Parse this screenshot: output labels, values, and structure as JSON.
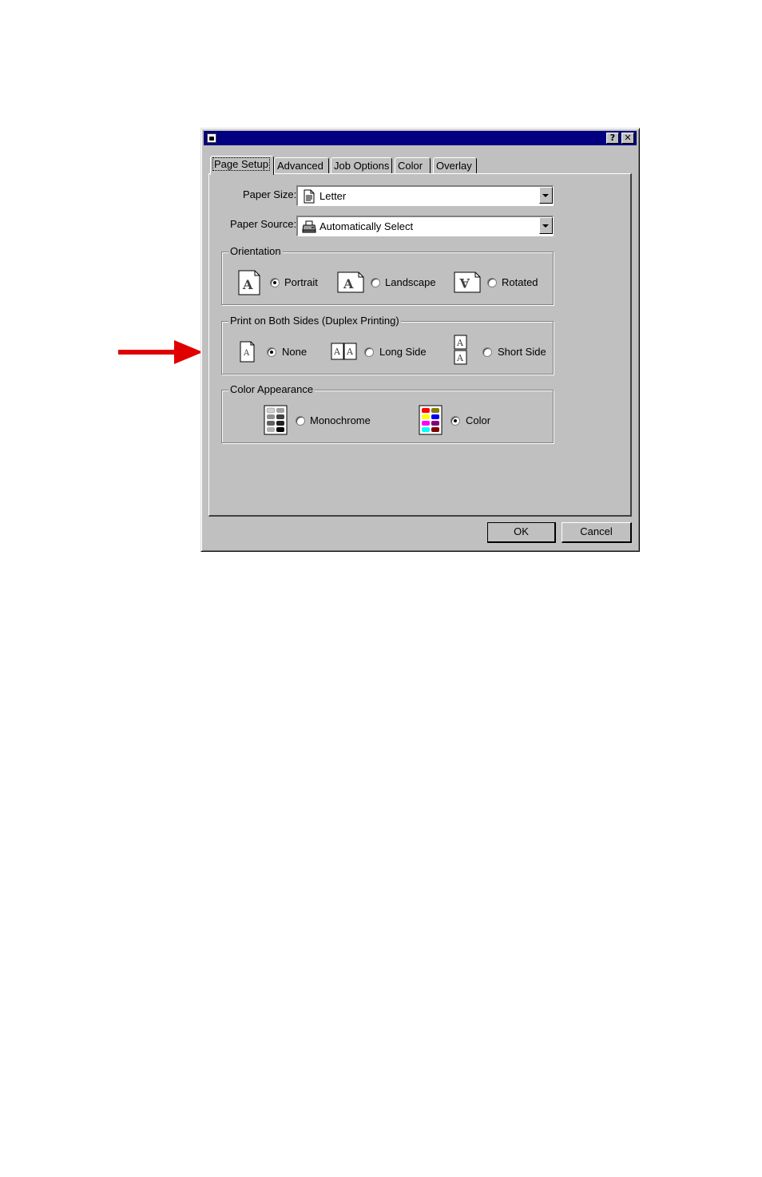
{
  "annotation": {
    "arrow_color": "#e00000",
    "icon": "red-arrow-icon"
  },
  "titlebar": {
    "title": "",
    "color": "#000080",
    "help_label": "?",
    "close_label": "✕"
  },
  "tabs": [
    "Page Setup",
    "Advanced",
    "Job Options",
    "Color",
    "Overlay"
  ],
  "active_tab": "Page Setup",
  "paper_size": {
    "label": "Paper Size:",
    "value": "Letter",
    "icon": "document-icon"
  },
  "paper_source": {
    "label": "Paper Source:",
    "value": "Automatically Select",
    "icon": "printer-icon"
  },
  "orientation": {
    "legend": "Orientation",
    "options": [
      {
        "label": "Portrait",
        "selected": true
      },
      {
        "label": "Landscape",
        "selected": false
      },
      {
        "label": "Rotated",
        "selected": false
      }
    ]
  },
  "duplex": {
    "legend": "Print on Both Sides (Duplex Printing)",
    "options": [
      {
        "label": "None",
        "selected": true
      },
      {
        "label": "Long Side",
        "selected": false
      },
      {
        "label": "Short Side",
        "selected": false
      }
    ]
  },
  "color_appearance": {
    "legend": "Color Appearance",
    "options": [
      {
        "label": "Monochrome",
        "selected": false
      },
      {
        "label": "Color",
        "selected": true
      }
    ]
  },
  "buttons": {
    "ok": "OK",
    "cancel": "Cancel"
  }
}
